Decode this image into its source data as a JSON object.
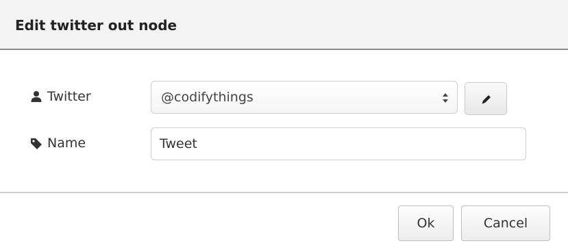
{
  "dialog": {
    "title": "Edit twitter out node"
  },
  "form": {
    "twitter": {
      "label": "Twitter",
      "icon": "user-icon",
      "selected_value": "@codifythings",
      "edit_icon": "pencil-icon"
    },
    "name": {
      "label": "Name",
      "icon": "tag-icon",
      "value": "Tweet"
    }
  },
  "footer": {
    "ok_label": "Ok",
    "cancel_label": "Cancel"
  }
}
